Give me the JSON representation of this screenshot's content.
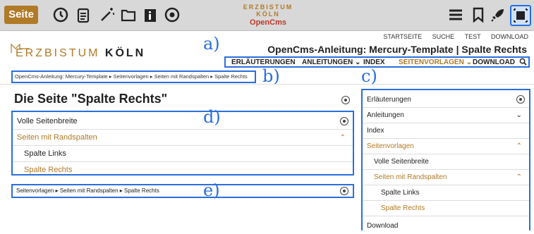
{
  "toolbar": {
    "seite_label": "Seite",
    "logo_line1": "ERZBISTUM KÖLN",
    "logo_line2": "OpenCms"
  },
  "header": {
    "logo_text": "ERZBISTUM",
    "logo_bold": "KÖLN",
    "top_links": [
      "STARTSEITE",
      "SUCHE",
      "TEST",
      "DOWNLOAD"
    ],
    "site_title": "OpenCms-Anleitung: Mercury-Template | Spalte Rechts",
    "nav": [
      "ERLÄUTERUNGEN",
      "ANLEITUNGEN ⌄",
      "INDEX",
      "SEITENVORLAGEN ⌄",
      "DOWNLOAD"
    ]
  },
  "breadcrumb": "OpenCms-Anleitung: Mercury-Template ▸ Seitenvorlagen ▸ Seiten mit Randspalten ▸ Spalte Rechts",
  "page_heading": "Die Seite \"Spalte Rechts\"",
  "left_nav": [
    "Volle Seitenbreite",
    "Seiten mit Randspalten",
    "Spalte Links",
    "Spalte Rechts"
  ],
  "bottom_breadcrumb": "Seitenvorlagen ▸ Seiten mit Randspalten ▸ Spalte Rechts",
  "right_nav": [
    "Erläuterungen",
    "Anleitungen",
    "Index",
    "Seitenvorlagen",
    "Volle Seitenbreite",
    "Seiten mit Randspalten",
    "Spalte Links",
    "Spalte Rechts",
    "Download"
  ],
  "annotations": {
    "a": "a)",
    "b": "b)",
    "c": "c)",
    "d": "d)",
    "e": "e)"
  },
  "colors": {
    "accent": "#b07a27",
    "annotation": "#2a6fdb"
  }
}
